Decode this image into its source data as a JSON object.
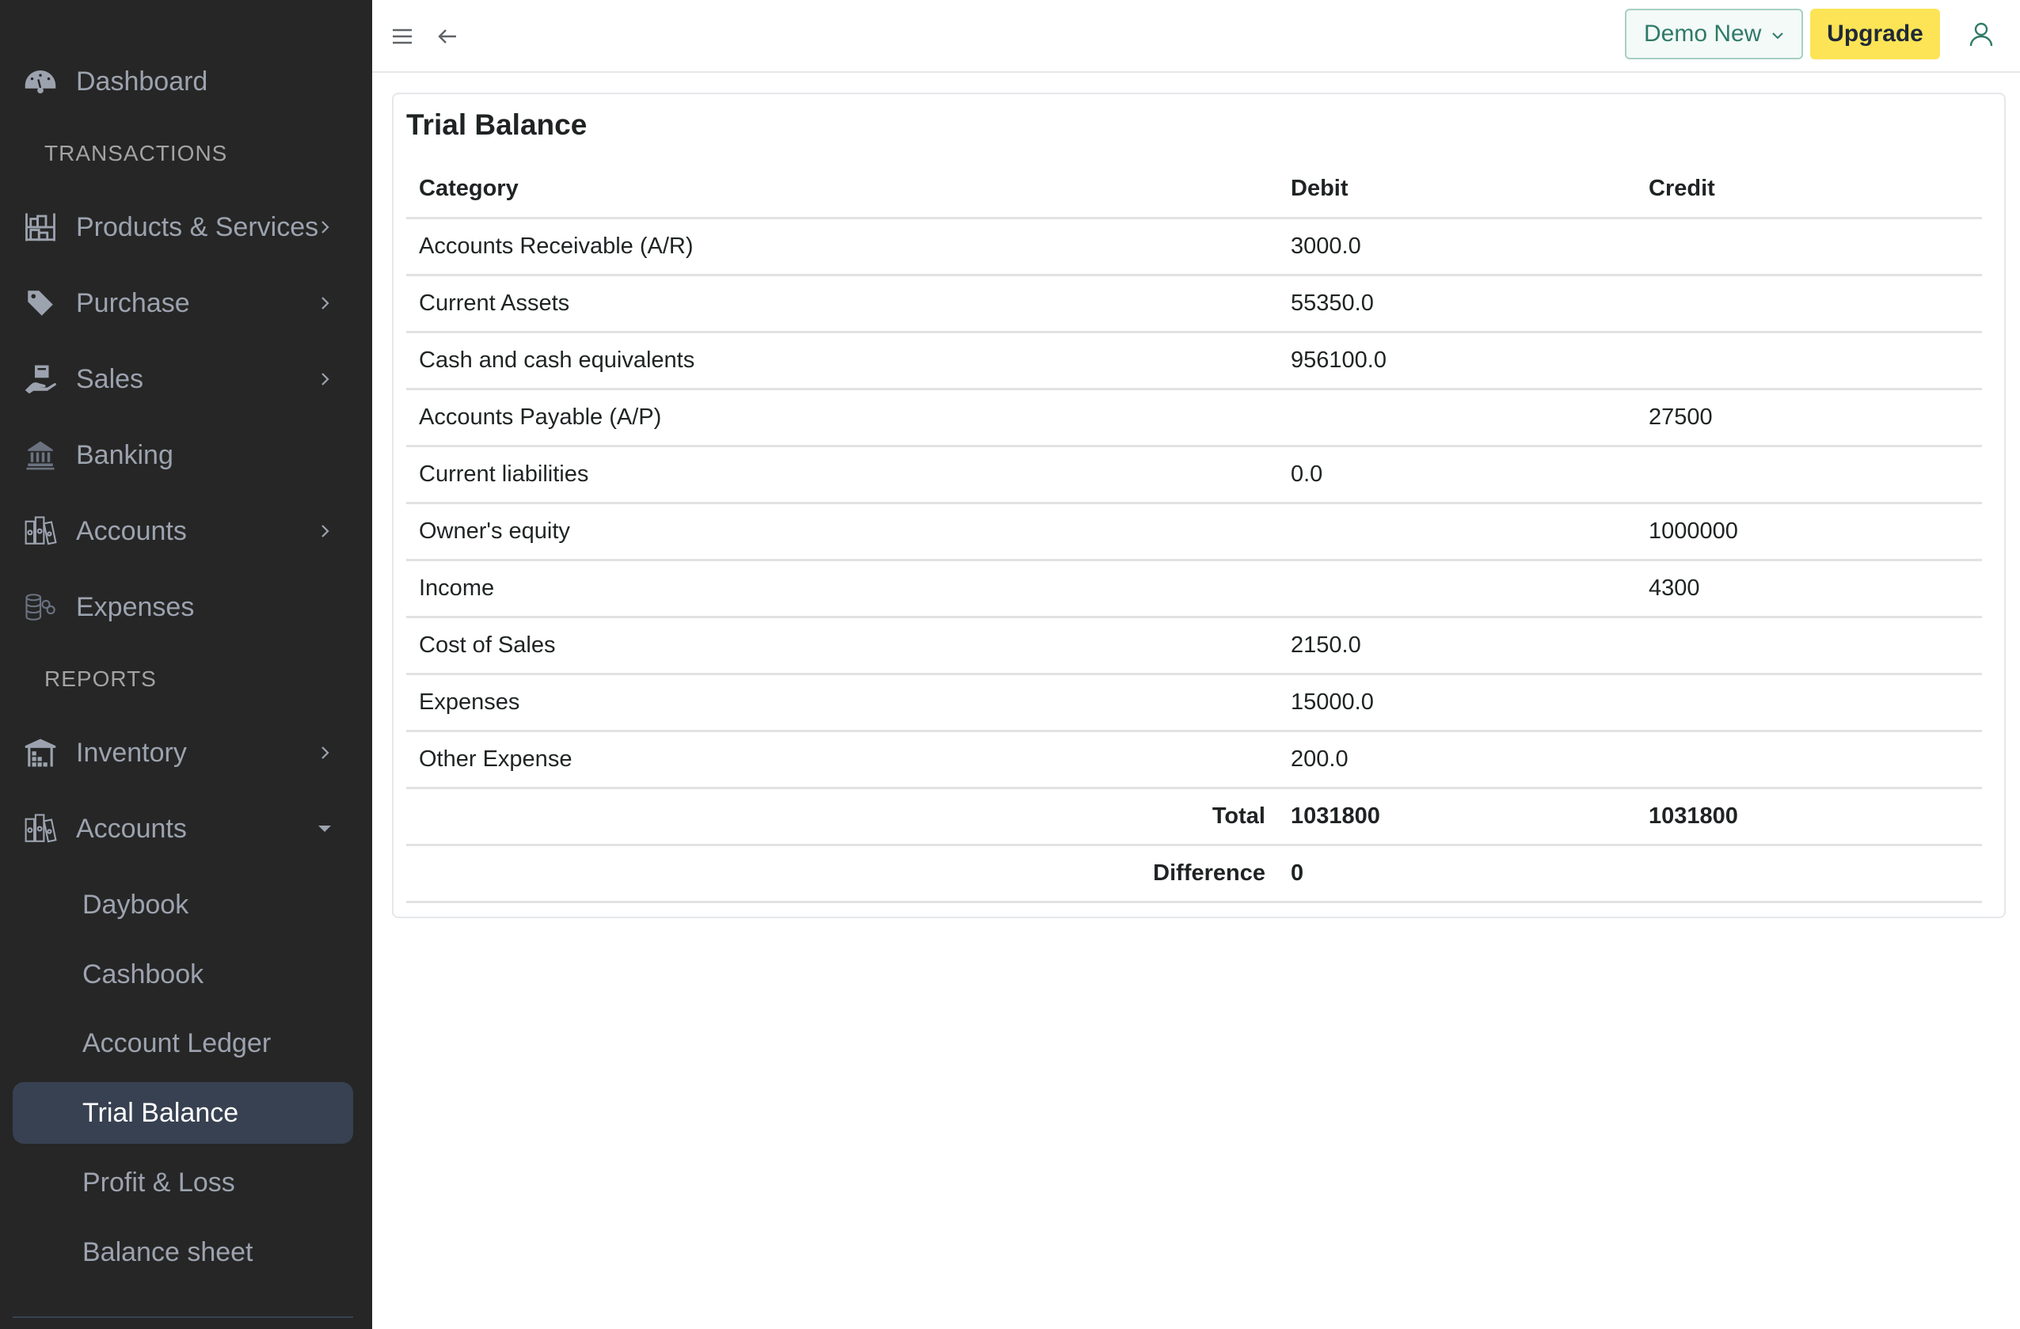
{
  "sidebar": {
    "items": [
      {
        "label": "Dashboard",
        "icon": "dashboard-gauge-icon"
      },
      {
        "label": "Products & Services",
        "icon": "warehouse-shelves-icon",
        "expandable": true
      },
      {
        "label": "Purchase",
        "icon": "tag-icon",
        "expandable": true
      },
      {
        "label": "Sales",
        "icon": "hand-box-icon",
        "expandable": true
      },
      {
        "label": "Banking",
        "icon": "bank-icon"
      },
      {
        "label": "Accounts",
        "icon": "binders-icon",
        "expandable": true
      },
      {
        "label": "Expenses",
        "icon": "coins-icon"
      },
      {
        "label": "Inventory",
        "icon": "warehouse-icon",
        "expandable": true
      },
      {
        "label": "Accounts",
        "icon": "binders-icon",
        "expanded": true
      }
    ],
    "sections": {
      "transactions": "TRANSACTIONS",
      "reports": "REPORTS"
    },
    "sub_items": [
      {
        "label": "Daybook"
      },
      {
        "label": "Cashbook"
      },
      {
        "label": "Account Ledger"
      },
      {
        "label": "Trial Balance",
        "active": true
      },
      {
        "label": "Profit & Loss"
      },
      {
        "label": "Balance sheet"
      }
    ]
  },
  "topbar": {
    "menu_icon": "hamburger-menu-icon",
    "back_icon": "arrow-left-icon",
    "company_selector": "Demo New",
    "upgrade_label": "Upgrade",
    "user_icon": "user-icon"
  },
  "report": {
    "title": "Trial Balance",
    "columns": [
      "Category",
      "Debit",
      "Credit"
    ],
    "rows": [
      {
        "category": "Accounts Receivable (A/R)",
        "debit": "3000.0",
        "credit": ""
      },
      {
        "category": "Current Assets",
        "debit": "55350.0",
        "credit": ""
      },
      {
        "category": "Cash and cash equivalents",
        "debit": "956100.0",
        "credit": ""
      },
      {
        "category": "Accounts Payable (A/P)",
        "debit": "",
        "credit": "27500"
      },
      {
        "category": "Current liabilities",
        "debit": "0.0",
        "credit": ""
      },
      {
        "category": "Owner's equity",
        "debit": "",
        "credit": "1000000"
      },
      {
        "category": "Income",
        "debit": "",
        "credit": "4300"
      },
      {
        "category": "Cost of Sales",
        "debit": "2150.0",
        "credit": ""
      },
      {
        "category": "Expenses",
        "debit": "15000.0",
        "credit": ""
      },
      {
        "category": "Other Expense",
        "debit": "200.0",
        "credit": ""
      }
    ],
    "total": {
      "label": "Total",
      "debit": "1031800",
      "credit": "1031800"
    },
    "difference": {
      "label": "Difference",
      "value": "0"
    }
  },
  "colors": {
    "sidebar_bg": "#262626",
    "sidebar_text": "#9ca3af",
    "active_item_bg": "#374151",
    "company_accent": "#2f7a66",
    "upgrade_bg": "#fde456"
  }
}
